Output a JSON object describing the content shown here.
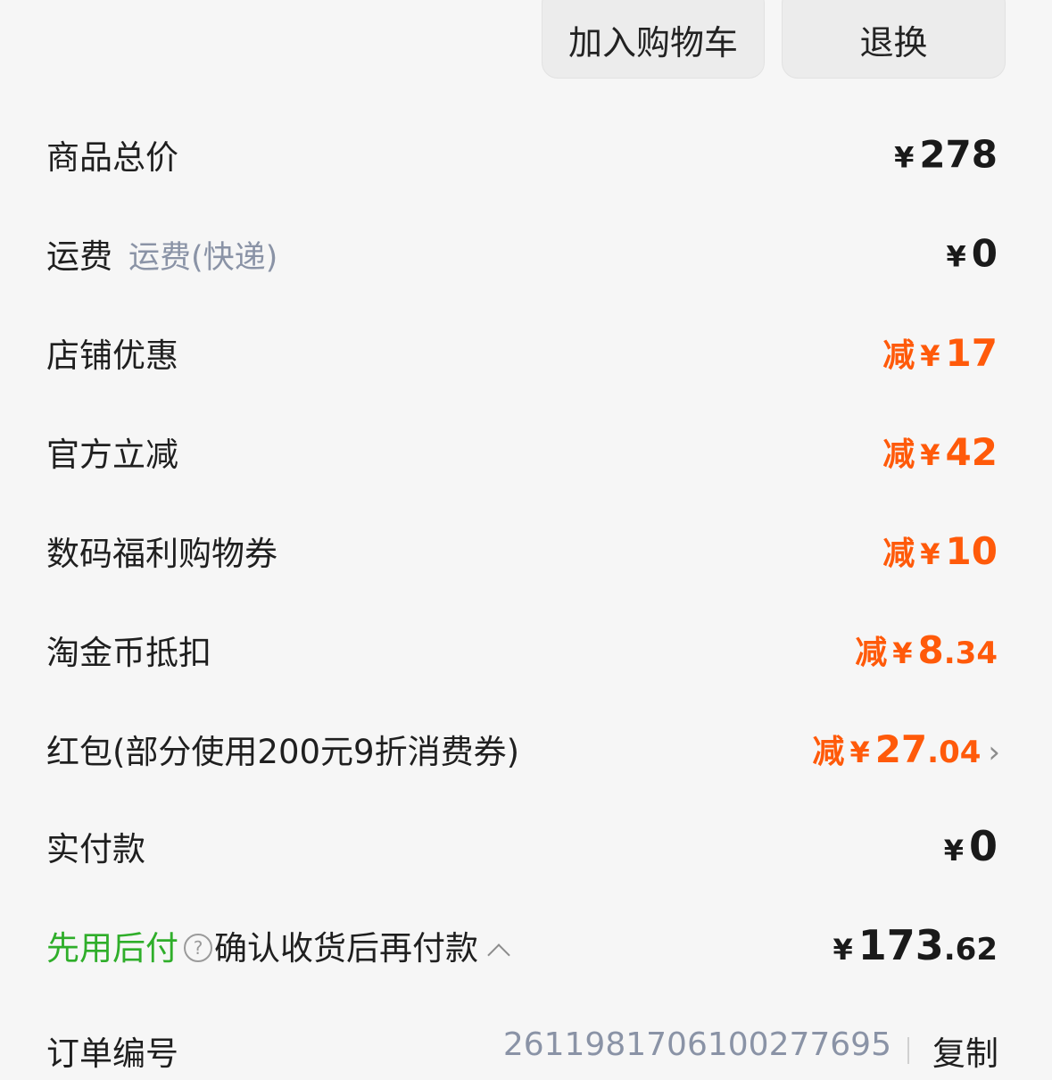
{
  "actions": {
    "add_to_cart": "加入购物车",
    "return_exchange": "退换"
  },
  "rows": {
    "total": {
      "label": "商品总价",
      "currency": "¥",
      "amount": "278"
    },
    "shipping": {
      "label": "运费",
      "sublabel": "运费(快递)",
      "currency": "¥",
      "amount": "0"
    },
    "store_discount": {
      "label": "店铺优惠",
      "prefix": "减",
      "currency": "¥",
      "amount": "17"
    },
    "official_discount": {
      "label": "官方立减",
      "prefix": "减",
      "currency": "¥",
      "amount": "42"
    },
    "digital_coupon": {
      "label": "数码福利购物券",
      "prefix": "减",
      "currency": "¥",
      "amount": "10"
    },
    "taojin_coins": {
      "label": "淘金币抵扣",
      "prefix": "减",
      "currency": "¥",
      "amount": "8",
      "cents": ".34"
    },
    "red_packet": {
      "label": "红包(部分使用200元9折消费券)",
      "prefix": "减",
      "currency": "¥",
      "amount": "27",
      "cents": ".04",
      "chevron": "›"
    },
    "actual_paid": {
      "label": "实付款",
      "currency": "¥",
      "amount": "0"
    },
    "pay_later": {
      "label_green": "先用后付",
      "help": "?",
      "label_rest": "确认收货后再付款",
      "currency": "¥",
      "amount": "173",
      "cents": ".62"
    }
  },
  "order": {
    "label": "订单编号",
    "number": "2611981706100277695",
    "copy": "复制"
  },
  "colors": {
    "discount": "#ff5a0a",
    "green": "#2fae2a",
    "muted": "#8a93a6"
  }
}
